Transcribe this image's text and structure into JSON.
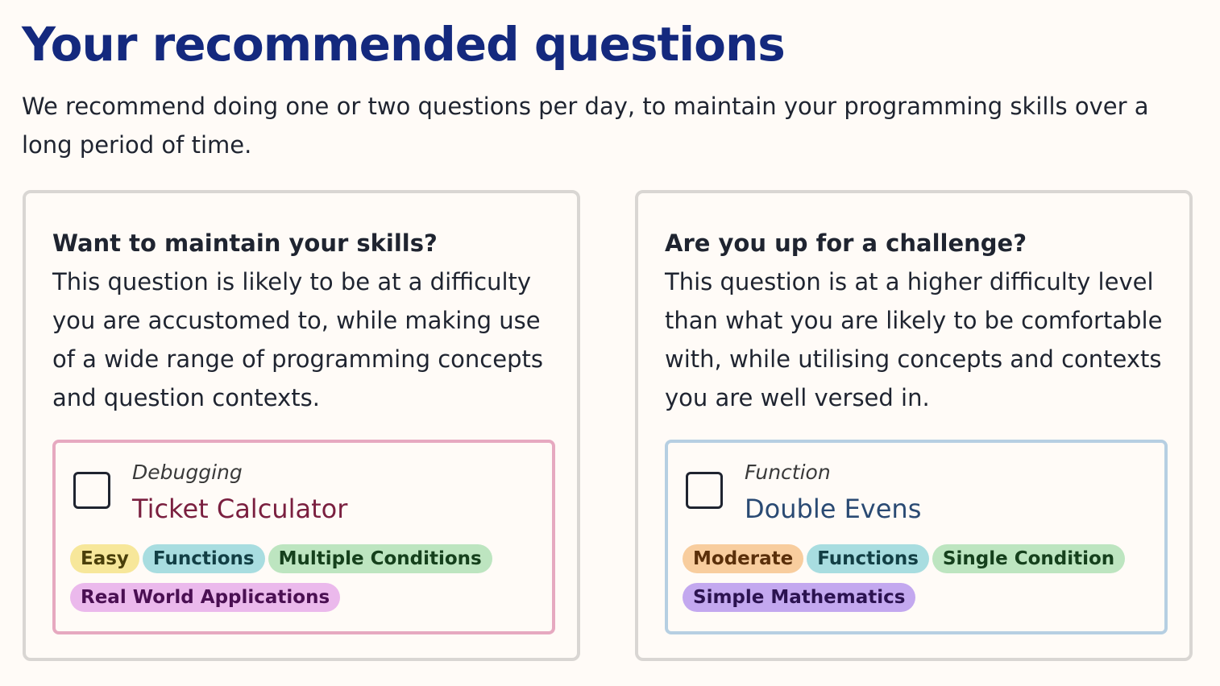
{
  "page": {
    "title": "Your recommended questions",
    "intro": "We recommend doing one or two questions per day, to maintain your programming skills over a long period of time."
  },
  "cards": [
    {
      "heading": "Want to maintain your skills?",
      "description": "This question is likely to be at a difficulty you are accustomed to, while making use of a wide range of programming concepts and question contexts.",
      "question": {
        "type": "Debugging",
        "title": "Ticket Calculator",
        "accent_color": "#e6a9c0",
        "completed": false,
        "tags": [
          "Easy",
          "Functions",
          "Multiple Conditions",
          "Real World Applications"
        ]
      }
    },
    {
      "heading": "Are you up for a challenge?",
      "description": "This question is at a higher difficulty level than what you are likely to be comfortable with, while utilising concepts and contexts you are well versed in.",
      "question": {
        "type": "Function",
        "title": "Double Evens",
        "accent_color": "#b6cfe2",
        "completed": false,
        "tags": [
          "Moderate",
          "Functions",
          "Single Condition",
          "Simple Mathematics"
        ]
      }
    }
  ],
  "colors": {
    "title": "#14297e",
    "background": "#fffbf7",
    "card_border": "#d9d6d3",
    "tag_easy": "#f7e79a",
    "tag_moderate": "#f8cd9e",
    "tag_functions": "#a8dde0",
    "tag_condition": "#bde5c0",
    "tag_real_world": "#ebb9ec",
    "tag_simple_math": "#c3a8ef"
  }
}
